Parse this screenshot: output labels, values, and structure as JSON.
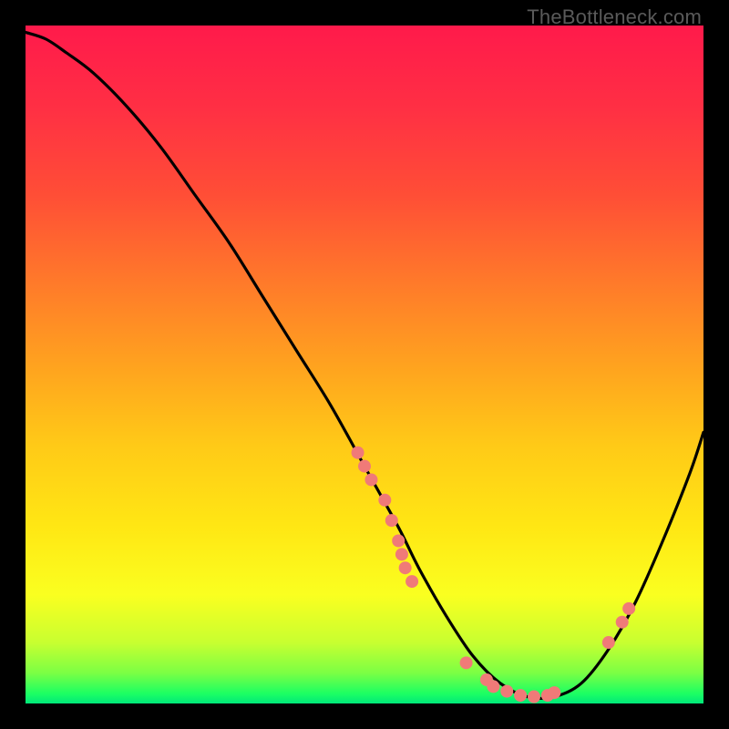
{
  "watermark": "TheBottleneck.com",
  "chart_data": {
    "type": "line",
    "title": "",
    "xlabel": "",
    "ylabel": "",
    "xlim": [
      0,
      100
    ],
    "ylim": [
      0,
      100
    ],
    "curve": {
      "name": "bottleneck-curve",
      "x": [
        0,
        3,
        6,
        10,
        15,
        20,
        25,
        30,
        35,
        40,
        45,
        50,
        55,
        58,
        62,
        66,
        70,
        74,
        78,
        82,
        86,
        90,
        94,
        98,
        100
      ],
      "y": [
        99,
        98,
        96,
        93,
        88,
        82,
        75,
        68,
        60,
        52,
        44,
        35,
        26,
        20,
        13,
        7,
        3,
        1,
        1,
        3,
        8,
        15,
        24,
        34,
        40
      ]
    },
    "markers": {
      "name": "highlight-points",
      "color": "#f07a78",
      "radius": 7,
      "points": [
        {
          "x": 49,
          "y": 37
        },
        {
          "x": 50,
          "y": 35
        },
        {
          "x": 51,
          "y": 33
        },
        {
          "x": 53,
          "y": 30
        },
        {
          "x": 54,
          "y": 27
        },
        {
          "x": 55,
          "y": 24
        },
        {
          "x": 55.5,
          "y": 22
        },
        {
          "x": 56,
          "y": 20
        },
        {
          "x": 57,
          "y": 18
        },
        {
          "x": 65,
          "y": 6
        },
        {
          "x": 68,
          "y": 3.5
        },
        {
          "x": 69,
          "y": 2.5
        },
        {
          "x": 71,
          "y": 1.8
        },
        {
          "x": 73,
          "y": 1.2
        },
        {
          "x": 75,
          "y": 1.0
        },
        {
          "x": 77,
          "y": 1.2
        },
        {
          "x": 78,
          "y": 1.6
        },
        {
          "x": 86,
          "y": 9
        },
        {
          "x": 88,
          "y": 12
        },
        {
          "x": 89,
          "y": 14
        }
      ]
    },
    "gradient": {
      "stops": [
        {
          "offset": 0.0,
          "color": "#ff1a4b"
        },
        {
          "offset": 0.12,
          "color": "#ff2f44"
        },
        {
          "offset": 0.25,
          "color": "#ff4e36"
        },
        {
          "offset": 0.38,
          "color": "#ff7a2a"
        },
        {
          "offset": 0.5,
          "color": "#ffa21f"
        },
        {
          "offset": 0.62,
          "color": "#ffca17"
        },
        {
          "offset": 0.74,
          "color": "#ffe714"
        },
        {
          "offset": 0.84,
          "color": "#faff20"
        },
        {
          "offset": 0.91,
          "color": "#c8ff30"
        },
        {
          "offset": 0.955,
          "color": "#7bff44"
        },
        {
          "offset": 0.985,
          "color": "#1dff62"
        },
        {
          "offset": 1.0,
          "color": "#00e87a"
        }
      ]
    }
  }
}
